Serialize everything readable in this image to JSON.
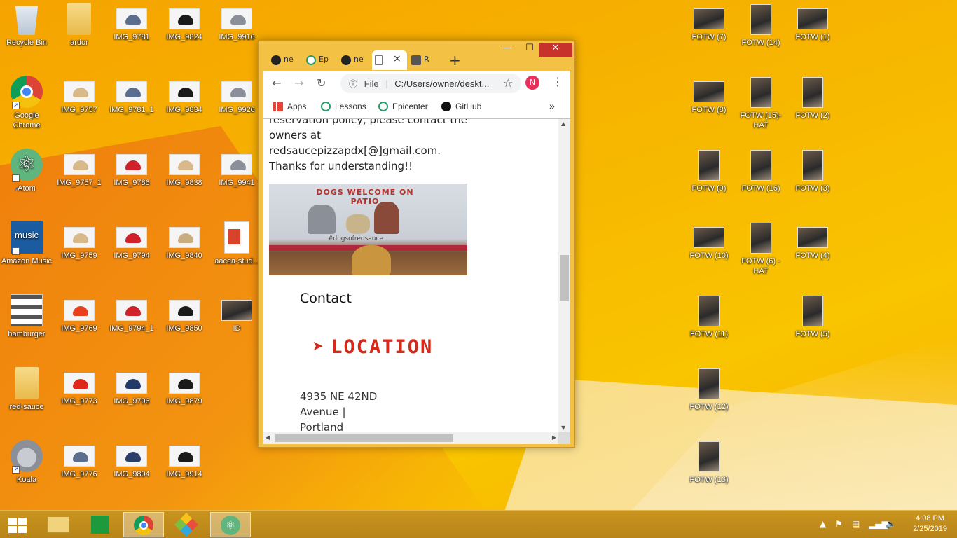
{
  "desktop": {
    "icons": [
      {
        "label": "Recycle Bin",
        "icon": "recycle-bin-icon"
      },
      {
        "label": "ardor",
        "icon": "folder-icon"
      },
      {
        "label": "IMG_9781",
        "icon": "image-icon"
      },
      {
        "label": "IMG_9824",
        "icon": "image-icon"
      },
      {
        "label": "IMG_9916",
        "icon": "image-icon"
      },
      {
        "label": "Google Chrome",
        "icon": "chrome-icon"
      },
      {
        "label": "IMG_9757",
        "icon": "image-icon"
      },
      {
        "label": "IMG_9781_1",
        "icon": "image-icon"
      },
      {
        "label": "IMG_9834",
        "icon": "image-icon"
      },
      {
        "label": "IMG_9926",
        "icon": "image-icon"
      },
      {
        "label": "Atom",
        "icon": "atom-icon"
      },
      {
        "label": "IMG_9757_1",
        "icon": "image-icon"
      },
      {
        "label": "IMG_9786",
        "icon": "image-icon"
      },
      {
        "label": "IMG_9838",
        "icon": "image-icon"
      },
      {
        "label": "IMG_9941",
        "icon": "image-icon"
      },
      {
        "label": "Amazon Music",
        "icon": "amazon-music-icon"
      },
      {
        "label": "IMG_9759",
        "icon": "image-icon"
      },
      {
        "label": "IMG_9794",
        "icon": "image-icon"
      },
      {
        "label": "IMG_9840",
        "icon": "image-icon"
      },
      {
        "label": "aacea-stud...",
        "icon": "pdf-icon"
      },
      {
        "label": "hamburger",
        "icon": "hamburger-icon"
      },
      {
        "label": "IMG_9769",
        "icon": "image-icon"
      },
      {
        "label": "IMG_9794_1",
        "icon": "image-icon"
      },
      {
        "label": "IMG_9850",
        "icon": "image-icon"
      },
      {
        "label": "ID",
        "icon": "image-icon"
      },
      {
        "label": "red-sauce",
        "icon": "folder-icon"
      },
      {
        "label": "IMG_9773",
        "icon": "image-icon"
      },
      {
        "label": "IMG_9796",
        "icon": "image-icon"
      },
      {
        "label": "IMG_9879",
        "icon": "image-icon"
      },
      {
        "label": "Koala",
        "icon": "koala-icon"
      },
      {
        "label": "IMG_9776",
        "icon": "image-icon"
      },
      {
        "label": "IMG_9804",
        "icon": "image-icon"
      },
      {
        "label": "IMG_9914",
        "icon": "image-icon"
      },
      {
        "label": "FOTW (7)",
        "icon": "image-icon"
      },
      {
        "label": "FOTW (14)",
        "icon": "image-icon"
      },
      {
        "label": "FOTW (1)",
        "icon": "image-icon"
      },
      {
        "label": "FOTW (8)",
        "icon": "image-icon"
      },
      {
        "label": "FOTW (15)-HAT",
        "icon": "image-icon"
      },
      {
        "label": "FOTW (2)",
        "icon": "image-icon"
      },
      {
        "label": "FOTW (9)",
        "icon": "image-icon"
      },
      {
        "label": "FOTW (16)",
        "icon": "image-icon"
      },
      {
        "label": "FOTW (3)",
        "icon": "image-icon"
      },
      {
        "label": "FOTW (10)",
        "icon": "image-icon"
      },
      {
        "label": "FOTW (6) -HAT",
        "icon": "image-icon"
      },
      {
        "label": "FOTW (4)",
        "icon": "image-icon"
      },
      {
        "label": "FOTW (11)",
        "icon": "image-icon"
      },
      {
        "label": "FOTW (5)",
        "icon": "image-icon"
      },
      {
        "label": "FOTW (12)",
        "icon": "image-icon"
      },
      {
        "label": "FOTW (13)",
        "icon": "image-icon"
      }
    ]
  },
  "browser": {
    "tabs": [
      {
        "label": "ne",
        "icon": "github-icon"
      },
      {
        "label": "Ep",
        "icon": "epicenter-icon"
      },
      {
        "label": "ne",
        "icon": "github-icon"
      },
      {
        "label": "",
        "icon": "document-icon",
        "active": true
      },
      {
        "label": "R",
        "icon": "cube-icon"
      }
    ],
    "close_tab": "×",
    "new_tab": "+",
    "window_controls": {
      "minimize": "—",
      "maximize": "☐",
      "close": "✕"
    },
    "address_scheme": "File",
    "address": "C:/Users/owner/deskt...",
    "profile_initial": "N",
    "bookmarks": [
      {
        "label": "Apps",
        "icon": "apps-grid-icon"
      },
      {
        "label": "Lessons",
        "icon": "epicenter-icon"
      },
      {
        "label": "Epicenter",
        "icon": "epicenter-icon"
      },
      {
        "label": "GitHub",
        "icon": "github-icon"
      }
    ],
    "bookmarks_more": "»",
    "page": {
      "top_text_partial": "reservation policy, please contact the",
      "line1": "owners at",
      "line2": "redsaucepizzapdx[@]gmail.com.",
      "line3": "Thanks for understanding!!",
      "image_sign": "DOGS WELCOME ON PATIO",
      "image_hashtag": "#dogsofredsauce",
      "contact_heading": "Contact",
      "location_heading": "LOCATION",
      "address_line1": "4935 NE 42ND",
      "address_line2": "Avenue |",
      "address_line3": "Portland"
    }
  },
  "taskbar": {
    "time": "4:08 PM",
    "date": "2/25/2019"
  },
  "colors": {
    "accent_red": "#d42a1b",
    "taskbar": "#c0891b",
    "profile": "#e8305a"
  }
}
